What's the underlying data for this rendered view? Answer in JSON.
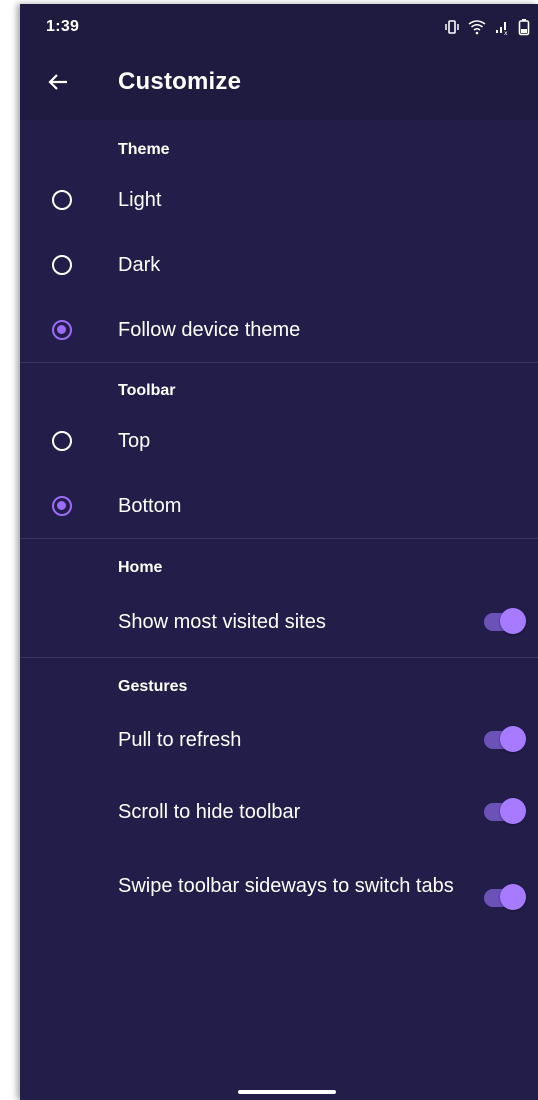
{
  "status_bar": {
    "time": "1:39",
    "icons": [
      "vibrate-icon",
      "wifi-icon",
      "signal-icon",
      "battery-icon"
    ]
  },
  "app_bar": {
    "title": "Customize",
    "back_icon": "arrow-back-icon"
  },
  "sections": {
    "theme": {
      "header": "Theme",
      "options": [
        {
          "label": "Light",
          "selected": false
        },
        {
          "label": "Dark",
          "selected": false
        },
        {
          "label": "Follow device theme",
          "selected": true
        }
      ]
    },
    "toolbar": {
      "header": "Toolbar",
      "options": [
        {
          "label": "Top",
          "selected": false
        },
        {
          "label": "Bottom",
          "selected": true
        }
      ]
    },
    "home": {
      "header": "Home",
      "switches": [
        {
          "label": "Show most visited sites",
          "on": true
        }
      ]
    },
    "gestures": {
      "header": "Gestures",
      "switches": [
        {
          "label": "Pull to refresh",
          "on": true
        },
        {
          "label": "Scroll to hide toolbar",
          "on": true
        },
        {
          "label": "Swipe toolbar sideways to switch tabs",
          "on": true
        }
      ]
    }
  },
  "colors": {
    "background": "#231d49",
    "accent": "#9b6cf7",
    "text": "#ffffff"
  }
}
